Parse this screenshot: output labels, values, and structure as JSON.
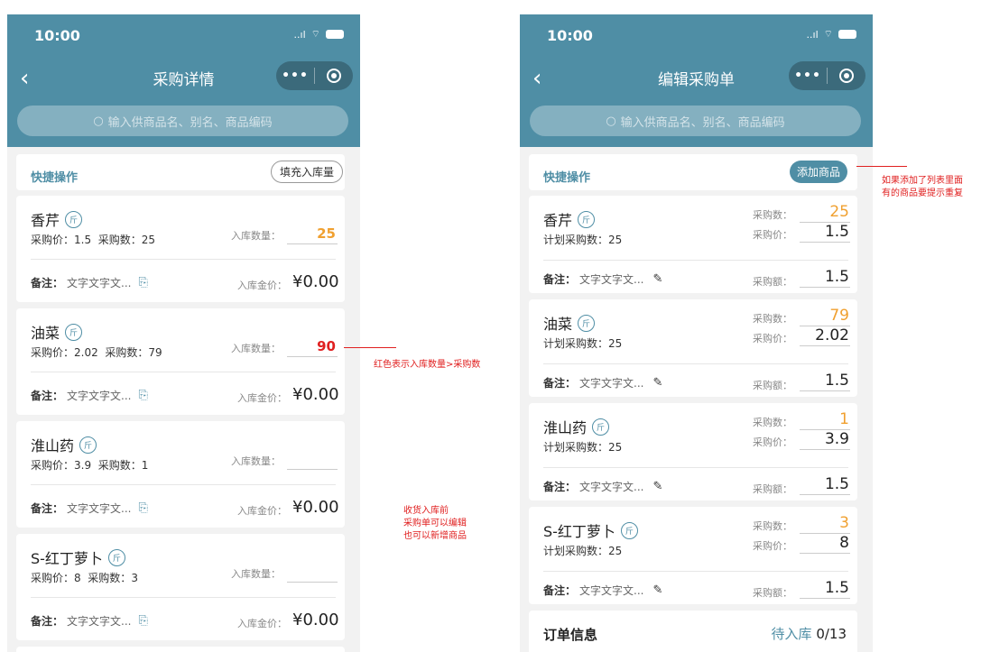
{
  "status_bar": {
    "time": "10:00",
    "signal": "..ıl",
    "wifi": "⌔"
  },
  "capsule": {
    "more": "•••"
  },
  "search": {
    "placeholder": "输入供商品名、别名、商品编码"
  },
  "colors": {
    "primary": "#4f8ea5",
    "orange": "#f0a030",
    "red": "#e02020"
  },
  "left": {
    "title": "采购详情",
    "quick_ops": "快捷操作",
    "fill_button": "填充入库量",
    "labels": {
      "price": "采购价：",
      "count": "采购数：",
      "in_qty": "入库数量：",
      "note": "备注：",
      "in_amount": "入库金价：",
      "unit": "斤"
    },
    "items": [
      {
        "name": "香芹",
        "price": "1.5",
        "count": "25",
        "in_qty": "25",
        "note": "文字文字文...",
        "amount": "¥0.00"
      },
      {
        "name": "油菜",
        "price": "2.02",
        "count": "79",
        "in_qty": "90",
        "note": "文字文字文...",
        "amount": "¥0.00"
      },
      {
        "name": "淮山药",
        "price": "3.9",
        "count": "1",
        "in_qty": "",
        "note": "文字文字文...",
        "amount": "¥0.00"
      },
      {
        "name": "S-红丁萝卜",
        "price": "8",
        "count": "3",
        "in_qty": "",
        "note": "文字文字文...",
        "amount": "¥0.00"
      }
    ]
  },
  "right": {
    "title": "编辑采购单",
    "quick_ops": "快捷操作",
    "add_button": "添加商品",
    "labels": {
      "plan_count": "计划采购数：",
      "count": "采购数：",
      "price": "采购价：",
      "note": "备注：",
      "amount": "采购额：",
      "unit": "斤"
    },
    "items": [
      {
        "name": "香芹",
        "plan": "25",
        "count": "25",
        "price": "1.5",
        "note": "文字文字文...",
        "amount": "1.5"
      },
      {
        "name": "油菜",
        "plan": "25",
        "count": "79",
        "price": "2.02",
        "note": "文字文字文...",
        "amount": "1.5"
      },
      {
        "name": "淮山药",
        "plan": "25",
        "count": "1",
        "price": "3.9",
        "note": "文字文字文...",
        "amount": "1.5"
      },
      {
        "name": "S-红丁萝卜",
        "plan": "25",
        "count": "3",
        "price": "8",
        "note": "文字文字文...",
        "amount": "1.5"
      }
    ],
    "order": {
      "title": "订单信息",
      "status": "待入库 ",
      "count": "0",
      "total": "/13"
    }
  },
  "annotations": {
    "red_rule": "红色表示入库数量>采购数",
    "edit_line1": "收货入库前",
    "edit_line2": "采购单可以编辑",
    "edit_line3": "也可以新增商品",
    "dup_line1": "如果添加了列表里面",
    "dup_line2": "有的商品要提示重复"
  }
}
